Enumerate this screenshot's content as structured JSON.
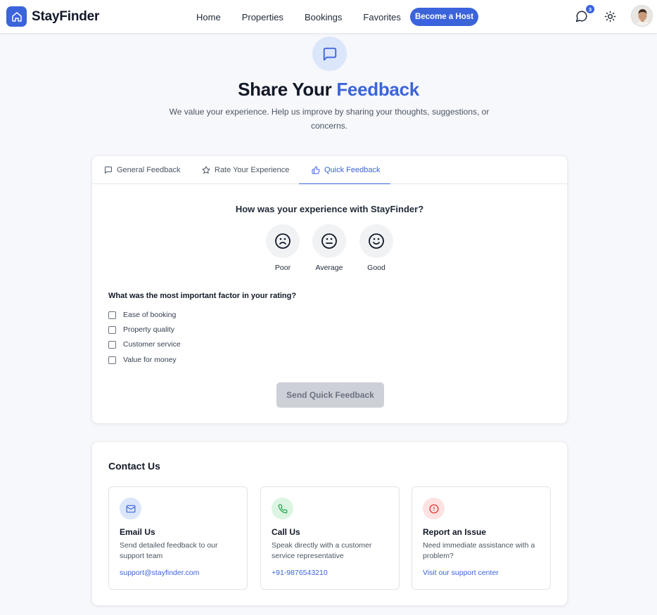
{
  "navbar": {
    "brand": "StayFinder",
    "links": [
      "Home",
      "Properties",
      "Bookings",
      "Favorites"
    ],
    "host_button": "Become a Host",
    "message_count": "3",
    "icons": {
      "logo": "home-icon",
      "messages": "chat-icon",
      "theme": "sun-icon",
      "avatar": "user-avatar"
    }
  },
  "hero": {
    "icon": "message-square-icon",
    "title_prefix": "Share Your",
    "title_accent": "Feedback",
    "subtitle": "We value your experience. Help us improve by sharing your thoughts, suggestions, or concerns."
  },
  "tabs": [
    {
      "label": "General Feedback",
      "icon": "message-square-icon",
      "active": false
    },
    {
      "label": "Rate Your Experience",
      "icon": "star-icon",
      "active": false
    },
    {
      "label": "Quick Feedback",
      "icon": "thumbs-up-icon",
      "active": true
    }
  ],
  "quick": {
    "question": "How was your experience with StayFinder?",
    "ratings": [
      {
        "label": "Poor",
        "icon": "frown-icon"
      },
      {
        "label": "Average",
        "icon": "meh-icon"
      },
      {
        "label": "Good",
        "icon": "smile-icon"
      }
    ],
    "factor_question": "What was the most important factor in your rating?",
    "factors": [
      "Ease of booking",
      "Property quality",
      "Customer service",
      "Value for money"
    ],
    "submit": "Send Quick Feedback"
  },
  "contact": {
    "title": "Contact Us",
    "items": [
      {
        "title": "Email Us",
        "desc": "Send detailed feedback to our support team",
        "link": "support@stayfinder.com",
        "icon": "mail-icon",
        "color": "#3b63db"
      },
      {
        "title": "Call Us",
        "desc": "Speak directly with a customer service representative",
        "link": "+91-9876543210",
        "icon": "phone-icon",
        "color": "#16a34a"
      },
      {
        "title": "Report an Issue",
        "desc": "Need immediate assistance with a problem?",
        "link": "Visit our support center",
        "icon": "alert-circle-icon",
        "color": "#dc2626"
      }
    ]
  },
  "colors": {
    "accent": "#3b63db",
    "background": "#f7f8fb",
    "disabled_button": "#cdd0d6"
  }
}
